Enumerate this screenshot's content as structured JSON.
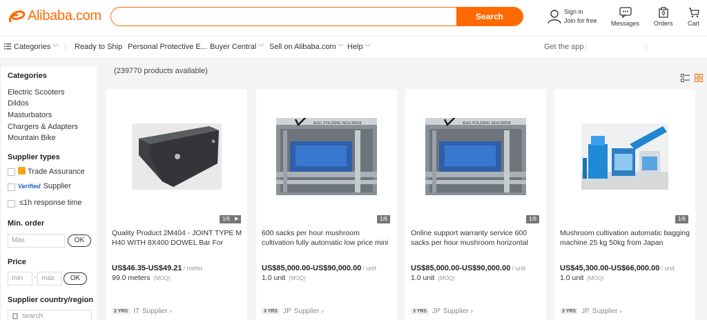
{
  "header": {
    "logo_text": "Alibaba.com",
    "search_placeholder": "",
    "search_button": "Search",
    "signin_line1": "Sign in",
    "signin_line2": "Join for free",
    "messages": "Messages",
    "orders": "Orders",
    "cart": "Cart",
    "brand_color": "#ff6a00"
  },
  "nav": {
    "categories": "Categories",
    "items": [
      "Ready to Ship",
      "Personal Protective E...",
      "Buyer Central",
      "Sell on Alibaba.com",
      "Help"
    ],
    "get_app": "Get the app"
  },
  "sidebar": {
    "categories_title": "Categories",
    "categories": [
      "Electric Scooters",
      "Dildos",
      "Masturbators",
      "Chargers & Adapters",
      "Mountain Bike"
    ],
    "supplier_types_title": "Supplier types",
    "trade_assurance": "Trade Assurance",
    "verified_badge": "Verified",
    "supplier": "Supplier",
    "response_time": "≤1h response time",
    "min_order_title": "Min. order",
    "max_placeholder": "Max",
    "ok": "OK",
    "price_title": "Price",
    "min_placeholder": "min",
    "price_dash": "-",
    "price_max_placeholder": "max",
    "country_title": "Supplier country/region",
    "country_search_placeholder": "search"
  },
  "main": {
    "product_count": "(239770 products available)"
  },
  "products": [
    {
      "title": "Quality Product 2M404 - JOINT TYPE M H40 WITH 8X400 DOWEL Bar For Gravel -",
      "price": "US$46.35-US$49.21",
      "unit": "/ meter",
      "moq": "99.0 meters",
      "moq_tag": "(MOQ)",
      "img_count": "1/6",
      "years": "2 YRS",
      "country": "IT",
      "supplier": "Supplier",
      "image_icon": "metal-bracket-photo"
    },
    {
      "title": "600 sacks per hour mushroom cultivation fully automatic low price mini paper",
      "price": "US$85,000.00-US$90,000.00",
      "unit": "/ unit",
      "moq": "1.0 unit",
      "moq_tag": "(MOQ)",
      "img_count": "1/6",
      "years": "3 YRS",
      "country": "JP",
      "supplier": "Supplier",
      "image_icon": "bag-folding-machine-photo"
    },
    {
      "title": "Online support warranty service 600 sacks per hour mushroom horizontal fully",
      "price": "US$85,000.00-US$90,000.00",
      "unit": "/ unit",
      "moq": "1.0 unit",
      "moq_tag": "(MOQ)",
      "img_count": "1/6",
      "years": "3 YRS",
      "country": "JP",
      "supplier": "Supplier",
      "image_icon": "bag-folding-machine-photo"
    },
    {
      "title": "Mushroom cultivation automatic bagging machine 25 kg 50kg from Japan",
      "price": "US$45,300.00-US$66,000.00",
      "unit": "/ unit",
      "moq": "1.0 unit",
      "moq_tag": "(MOQ)",
      "img_count": "1/6",
      "years": "3 YRS",
      "country": "JP",
      "supplier": "Supplier",
      "image_icon": "blue-bagging-machine-photo"
    }
  ],
  "machine_label": "BAG FOLDING MACHINE"
}
